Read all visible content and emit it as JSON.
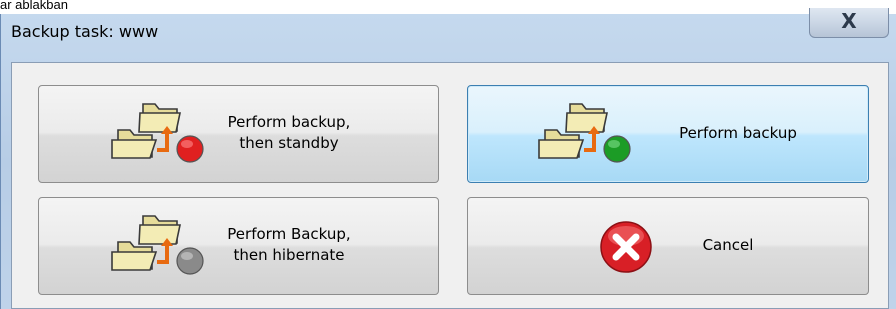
{
  "background_text": "ar ablakban",
  "window": {
    "title": "Backup task: www",
    "close_label": "X"
  },
  "buttons": {
    "backup_standby": {
      "line1": "Perform backup,",
      "line2": "then standby",
      "status_icon": "red-status-dot"
    },
    "backup": {
      "label": "Perform backup",
      "status_icon": "green-status-dot"
    },
    "backup_hibernate": {
      "line1": "Perform Backup,",
      "line2": "then hibernate",
      "status_icon": "gray-status-dot"
    },
    "cancel": {
      "label": "Cancel",
      "icon": "error-x-icon"
    }
  },
  "colors": {
    "titlebar": "#c5d9ee",
    "focus_border": "#3c7fb1",
    "red_dot": "#e02020",
    "green_dot": "#1c9c26",
    "gray_dot": "#8a8a8a",
    "cancel_red": "#d81f26"
  }
}
